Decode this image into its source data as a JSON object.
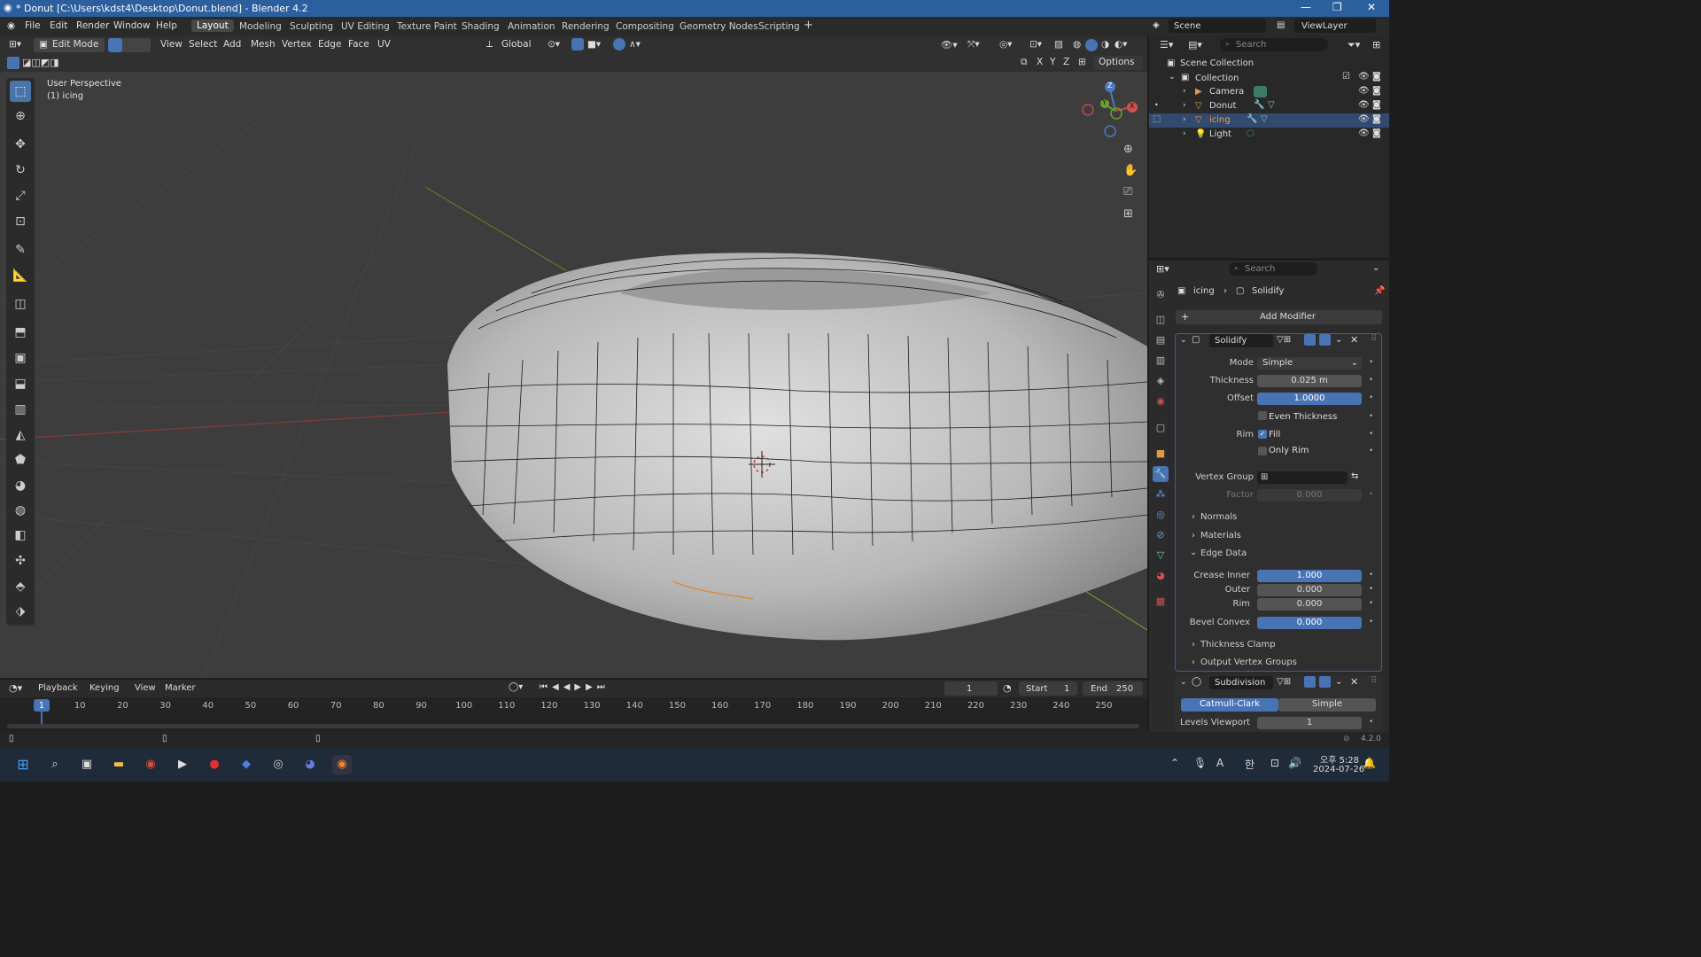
{
  "window": {
    "title": "* Donut [C:\\Users\\kdst4\\Desktop\\Donut.blend] - Blender 4.2"
  },
  "menu": {
    "file": "File",
    "edit": "Edit",
    "render": "Render",
    "window": "Window",
    "help": "Help"
  },
  "workspaces": [
    "Layout",
    "Modeling",
    "Sculpting",
    "UV Editing",
    "Texture Paint",
    "Shading",
    "Animation",
    "Rendering",
    "Compositing",
    "Geometry Nodes",
    "Scripting"
  ],
  "scene": {
    "scene": "Scene",
    "viewlayer": "ViewLayer"
  },
  "viewport_header": {
    "mode": "Edit Mode",
    "view": "View",
    "select": "Select",
    "add": "Add",
    "mesh": "Mesh",
    "vertex": "Vertex",
    "edge": "Edge",
    "face": "Face",
    "uv": "UV",
    "orientation": "Global",
    "options": "Options",
    "x": "X",
    "y": "Y",
    "z": "Z"
  },
  "viewport": {
    "perspective": "User Perspective",
    "object": "(1) icing",
    "gizmo_z": "Z",
    "gizmo_y": "Y",
    "gizmo_x": "X"
  },
  "outliner": {
    "search": "Search",
    "scene_collection": "Scene Collection",
    "collection": "Collection",
    "items": [
      "Camera",
      "Donut",
      "icing",
      "Light"
    ]
  },
  "properties": {
    "search": "Search",
    "object": "icing",
    "modifier_path": "Solidify",
    "add_modifier": "Add Modifier",
    "solidify": {
      "name": "Solidify",
      "mode_label": "Mode",
      "mode": "Simple",
      "thickness_label": "Thickness",
      "thickness": "0.025 m",
      "offset_label": "Offset",
      "offset": "1.0000",
      "even_thickness": "Even Thickness",
      "rim_label": "Rim",
      "fill": "Fill",
      "only_rim": "Only Rim",
      "vertex_group_label": "Vertex Group",
      "factor_label": "Factor",
      "factor": "0.000",
      "normals": "Normals",
      "materials": "Materials",
      "edge_data": "Edge Data",
      "crease_inner_label": "Crease Inner",
      "crease_inner": "1.000",
      "outer_label": "Outer",
      "outer": "0.000",
      "rim2_label": "Rim",
      "rim2": "0.000",
      "bevel_convex_label": "Bevel Convex",
      "bevel_convex": "0.000",
      "thickness_clamp": "Thickness Clamp",
      "output_vertex_groups": "Output Vertex Groups"
    },
    "subdivision": {
      "name": "Subdivision",
      "catmull": "Catmull-Clark",
      "simple": "Simple",
      "levels_label": "Levels Viewport",
      "levels": "1"
    }
  },
  "timeline": {
    "playback": "Playback",
    "keying": "Keying",
    "view": "View",
    "marker": "Marker",
    "current": "1",
    "start_label": "Start",
    "start": "1",
    "end_label": "End",
    "end": "250",
    "ticks": [
      "1",
      "10",
      "20",
      "30",
      "40",
      "50",
      "60",
      "70",
      "80",
      "90",
      "100",
      "110",
      "120",
      "130",
      "140",
      "150",
      "160",
      "170",
      "180",
      "190",
      "200",
      "210",
      "220",
      "230",
      "240",
      "250"
    ]
  },
  "status": {
    "version": "4.2.0"
  },
  "taskbar": {
    "time": "오후 5:28",
    "date": "2024-07-26",
    "ime": "A",
    "ime2": "한"
  }
}
